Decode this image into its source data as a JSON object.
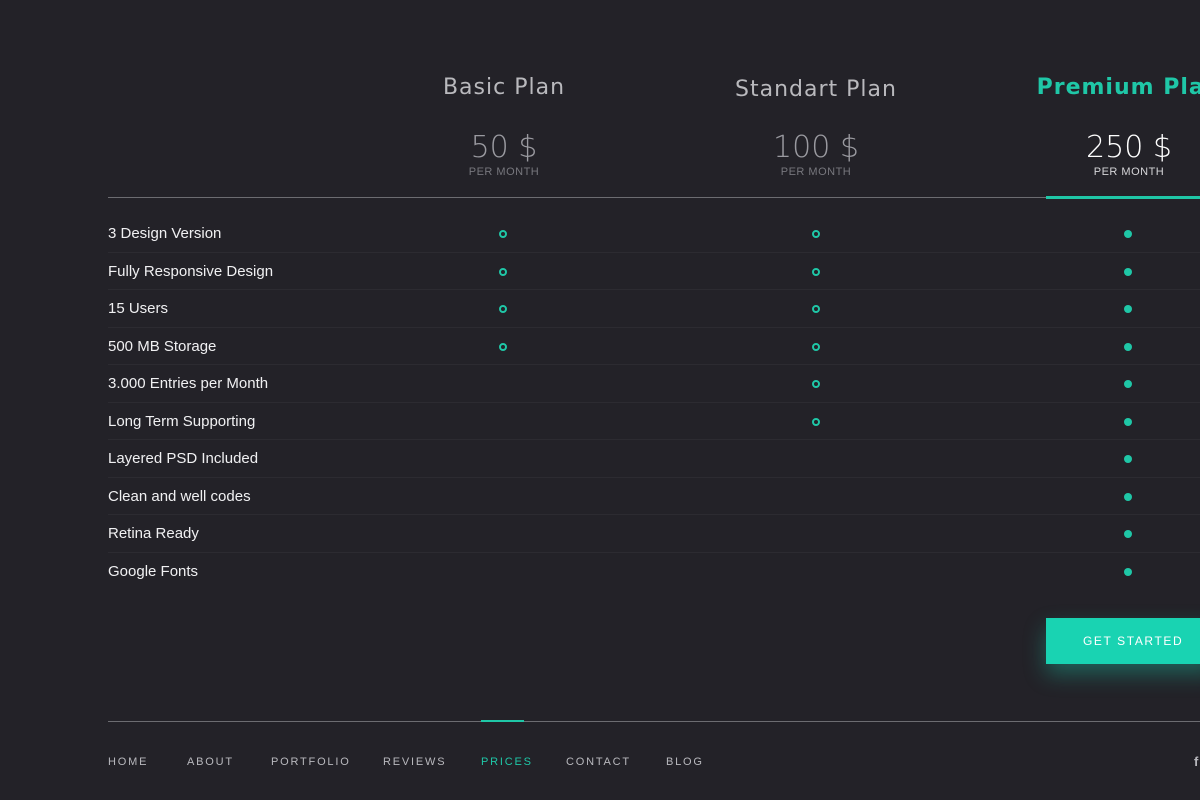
{
  "plans": [
    {
      "name": "Basic Plan",
      "price": "50 $",
      "period": "PER MONTH"
    },
    {
      "name": "Standart Plan",
      "price": "100 $",
      "period": "PER MONTH"
    },
    {
      "name": "Premium Plan",
      "price": "250 $",
      "period": "PER MONTH"
    }
  ],
  "features": [
    {
      "label": "3 Design Version",
      "basic": true,
      "standart": true,
      "premium": true
    },
    {
      "label": "Fully Responsive Design",
      "basic": true,
      "standart": true,
      "premium": true
    },
    {
      "label": "15 Users",
      "basic": true,
      "standart": true,
      "premium": true
    },
    {
      "label": "500 MB Storage",
      "basic": true,
      "standart": true,
      "premium": true
    },
    {
      "label": "3.000 Entries per Month",
      "basic": false,
      "standart": true,
      "premium": true
    },
    {
      "label": "Long Term Supporting",
      "basic": false,
      "standart": true,
      "premium": true
    },
    {
      "label": "Layered PSD Included",
      "basic": false,
      "standart": false,
      "premium": true
    },
    {
      "label": "Clean and well codes",
      "basic": false,
      "standart": false,
      "premium": true
    },
    {
      "label": "Retina Ready",
      "basic": false,
      "standart": false,
      "premium": true
    },
    {
      "label": "Google Fonts",
      "basic": false,
      "standart": false,
      "premium": true
    }
  ],
  "cta": {
    "label": "GET STARTED"
  },
  "nav": {
    "items": [
      {
        "label": "HOME",
        "active": false
      },
      {
        "label": "ABOUT",
        "active": false
      },
      {
        "label": "PORTFOLIO",
        "active": false
      },
      {
        "label": "REVIEWS",
        "active": false
      },
      {
        "label": "PRICES",
        "active": true
      },
      {
        "label": "CONTACT",
        "active": false
      },
      {
        "label": "BLOG",
        "active": false
      }
    ]
  },
  "social": {
    "icon": "facebook-icon",
    "glyph": "f"
  },
  "colors": {
    "background": "#232228",
    "accent": "#1fc7a7",
    "cta": "#19d3b2",
    "divider": "#6c6c71"
  }
}
